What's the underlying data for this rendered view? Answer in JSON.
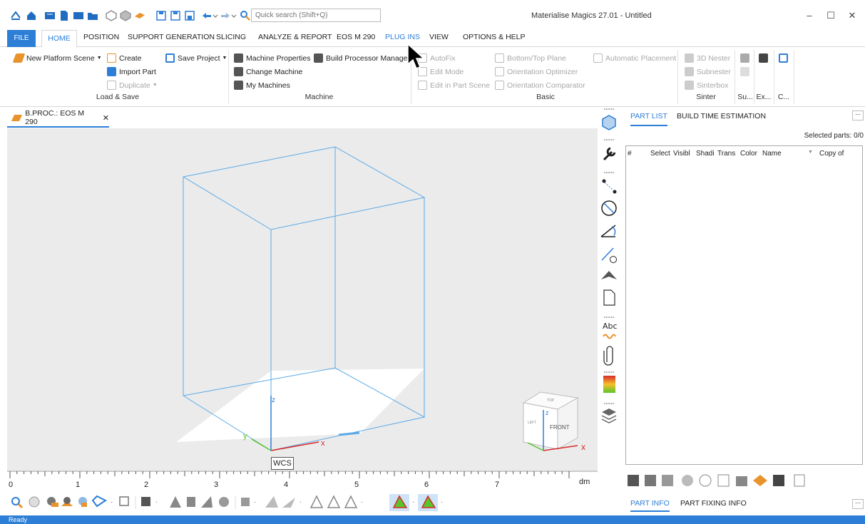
{
  "window": {
    "title": "Materialise Magics 27.01 - Untitled",
    "search_placeholder": "Quick search (Shift+Q)",
    "minimize": "–",
    "maximize": "☐",
    "close": "✕"
  },
  "ribbon_tabs": [
    "FILE",
    "HOME",
    "POSITION",
    "SUPPORT GENERATION",
    "SLICING",
    "ANALYZE & REPORT",
    "EOS M 290",
    "PLUG INS",
    "VIEW",
    "OPTIONS & HELP"
  ],
  "ribbon": {
    "load_save": {
      "new_platform_scene": "New Platform Scene",
      "create": "Create",
      "import_part": "Import Part",
      "duplicate": "Duplicate",
      "save_project": "Save Project",
      "group": "Load & Save"
    },
    "machine": {
      "machine_properties": "Machine Properties",
      "build_processor_manager": "Build Processor Manager",
      "change_machine": "Change Machine",
      "my_machines": "My Machines",
      "group": "Machine"
    },
    "basic": {
      "autofix": "AutoFix",
      "edit_mode": "Edit Mode",
      "edit_in_part_scene": "Edit in Part Scene",
      "bottom_top_plane": "Bottom/Top Plane",
      "orientation_optimizer": "Orientation Optimizer",
      "orientation_comparator": "Orientation Comparator",
      "automatic_placement": "Automatic Placement",
      "group": "Basic"
    },
    "sinter": {
      "nester_3d": "3D Nester",
      "subnester": "Subnester",
      "sinterbox": "Sinterbox",
      "group": "Sinter"
    },
    "extra_groups": [
      "Su...",
      "Ex...",
      "C..."
    ]
  },
  "doc_tab": {
    "label": "B.PROC.: EOS M 290",
    "close": "✕"
  },
  "viewport": {
    "wcs": "WCS",
    "axis_x": "x",
    "axis_y": "y",
    "axis_z": "z",
    "cube_front": "FRONT",
    "cube_left": "LEFT",
    "cube_top": "TOP",
    "ruler_ticks": [
      "0",
      "1",
      "2",
      "3",
      "4",
      "5",
      "6",
      "7"
    ],
    "ruler_unit": "dm"
  },
  "right_panel": {
    "tab_part_list": "PART LIST",
    "tab_build_time": "BUILD TIME ESTIMATION",
    "selected_parts": "Selected parts: 0/0",
    "columns": [
      "#",
      "Select",
      "Visibl",
      "Shadi",
      "Trans",
      "Color",
      "Name",
      "Copy of"
    ],
    "tab_part_info": "PART INFO",
    "tab_part_fixing": "PART FIXING INFO",
    "more": "⋯"
  },
  "status": "Ready",
  "colors": {
    "accent": "#2c7ed6",
    "box": "#5aa9e6"
  }
}
